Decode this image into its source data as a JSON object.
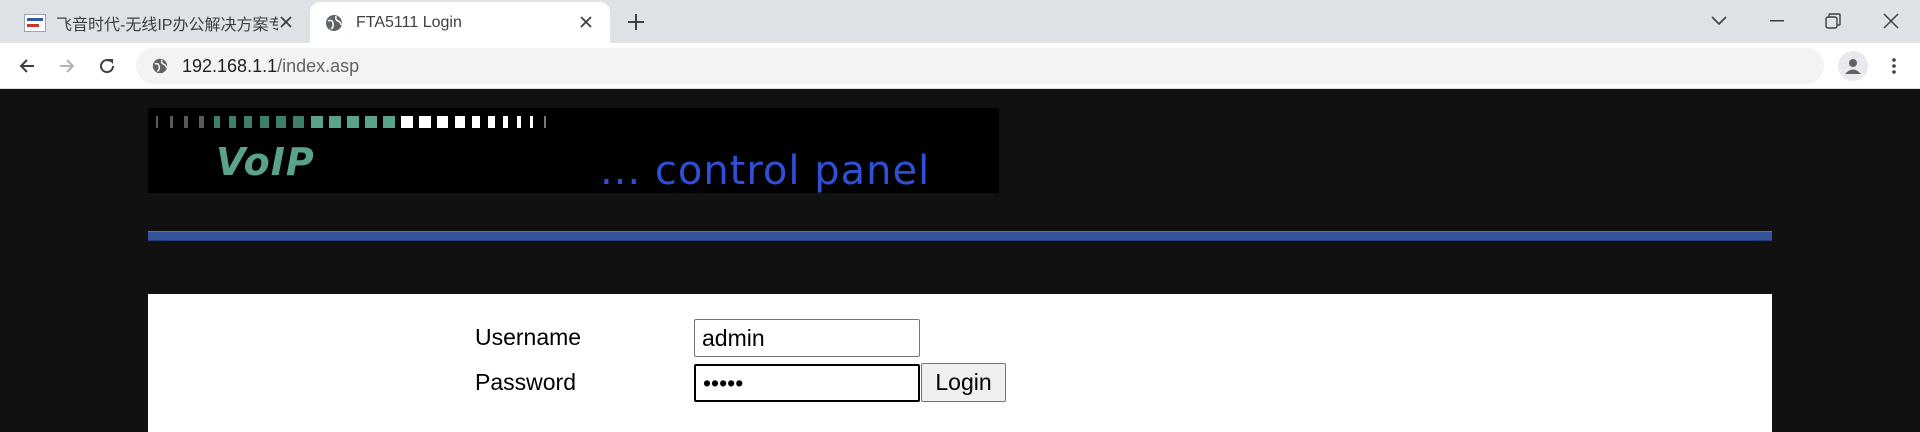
{
  "browser": {
    "tabs": [
      {
        "title": "飞音时代-无线IP办公解决方案专",
        "active": false
      },
      {
        "title": "FTA5111 Login",
        "active": true
      }
    ],
    "address_bar": {
      "host": "192.168.1.1",
      "path": "/index.asp"
    },
    "icons": {
      "favicon_inactive": "site-thumbnail-icon",
      "favicon_active": "globe-icon",
      "close": "close-icon",
      "new_tab": "plus-icon",
      "tab_search": "chevron-down-icon",
      "minimize": "minimize-icon",
      "restore": "restore-icon",
      "close_window": "close-window-icon",
      "back": "back-arrow-icon",
      "forward": "forward-arrow-icon",
      "reload": "reload-icon",
      "site_info": "globe-icon",
      "profile": "profile-icon",
      "menu": "kebab-menu-icon"
    }
  },
  "page": {
    "banner": {
      "title": "VoIP",
      "subtitle": "... control panel"
    },
    "colors": {
      "background": "#111111",
      "divider": "#34539b",
      "banner_title": "#5aa38a",
      "banner_subtitle": "#2f4fd6",
      "led_on": "#5aa38a",
      "led_bright": "#ffffff"
    },
    "login_form": {
      "username_label": "Username",
      "username_value": "admin",
      "password_label": "Password",
      "password_value": "•••••",
      "login_button": "Login"
    }
  }
}
